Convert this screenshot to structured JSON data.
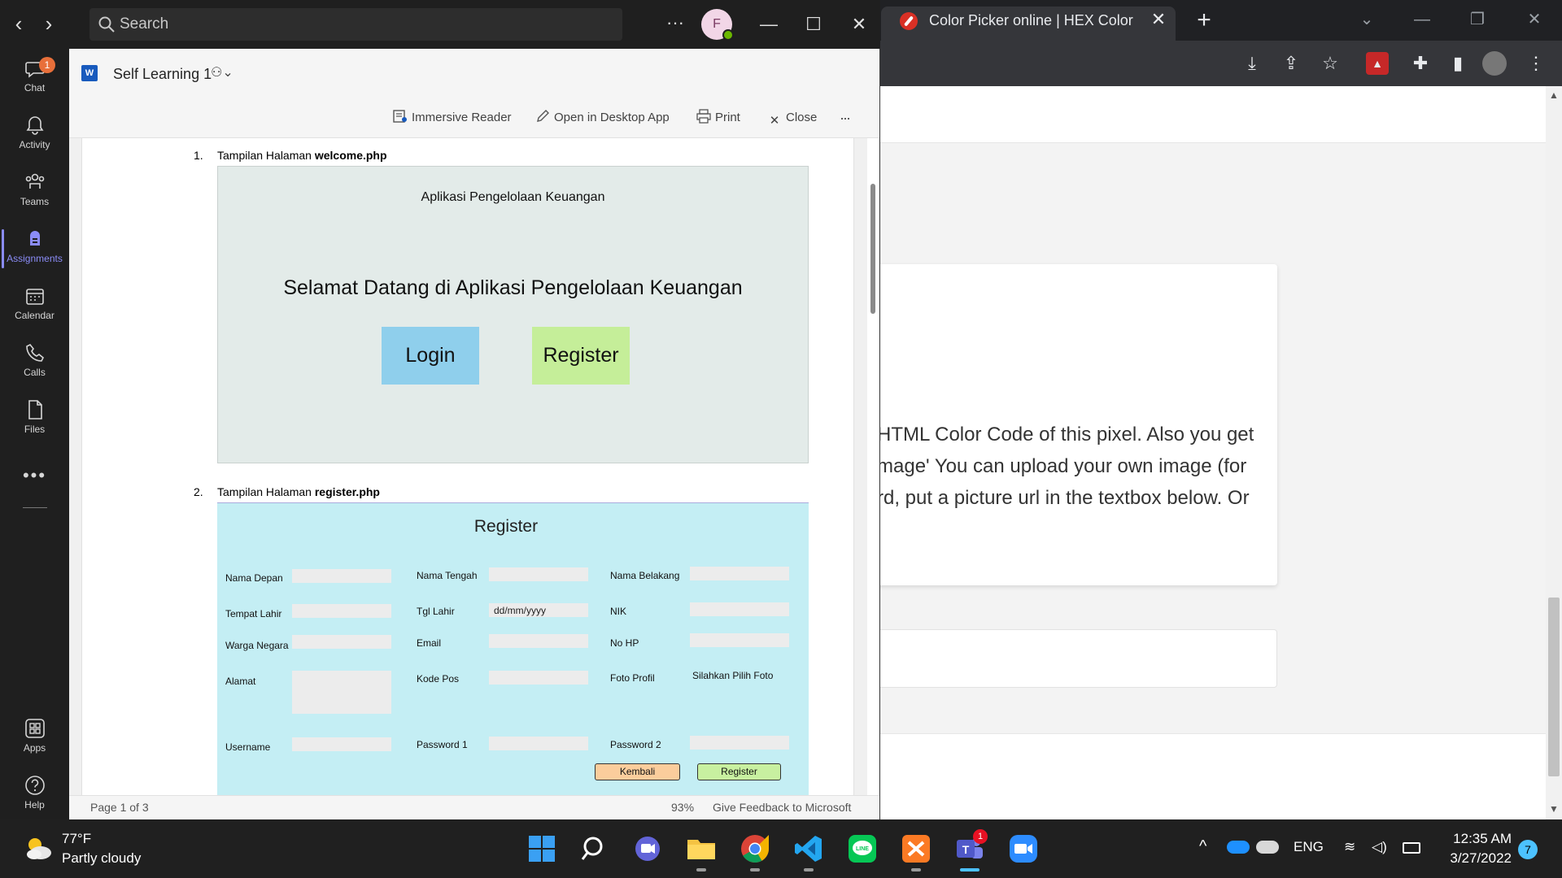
{
  "browser": {
    "tab_title": "Color Picker online | HEX Color",
    "page_text": "HTML Color Code of this pixel. Also you get 'mage' You can upload your own image (for rd, put a picture url in the textbox below. Or",
    "page_lines": [
      "HTML Color Code of this pixel. Also you get",
      "mage' You can upload your own image (for",
      "rd, put a picture url in the textbox below. Or"
    ]
  },
  "teams": {
    "search_placeholder": "Search",
    "avatar_initial": "F",
    "rail": [
      {
        "label": "Chat",
        "icon": "chat-icon",
        "badge": "1"
      },
      {
        "label": "Activity",
        "icon": "bell-icon"
      },
      {
        "label": "Teams",
        "icon": "teams-icon"
      },
      {
        "label": "Assignments",
        "icon": "assignments-icon",
        "active": true
      },
      {
        "label": "Calendar",
        "icon": "calendar-icon"
      },
      {
        "label": "Calls",
        "icon": "phone-icon"
      },
      {
        "label": "Files",
        "icon": "file-icon"
      },
      {
        "label": "Apps",
        "icon": "apps-icon"
      },
      {
        "label": "Help",
        "icon": "help-icon"
      }
    ],
    "rail_more": "•••"
  },
  "word": {
    "app_badge": "W",
    "doc_name": "Self Learning 1",
    "commands": {
      "immersive_reader": "Immersive Reader",
      "open_desktop": "Open in Desktop App",
      "print": "Print",
      "close": "Close",
      "more": "···"
    },
    "status": {
      "page": "Page 1 of 3",
      "zoom": "93%",
      "feedback": "Give Feedback to Microsoft"
    },
    "items": [
      {
        "num": "1.",
        "prefix": "Tampilan Halaman ",
        "file": "welcome.php"
      },
      {
        "num": "2.",
        "prefix": "Tampilan Halaman ",
        "file": "register.php"
      }
    ],
    "welcome_mock": {
      "app_title": "Aplikasi Pengelolaan Keuangan",
      "heading": "Selamat Datang di Aplikasi Pengelolaan Keuangan",
      "login": "Login",
      "register": "Register",
      "colors": {
        "login": "#8fcfec",
        "register": "#c5ee99",
        "background": "#e3ebe9"
      }
    },
    "register_mock": {
      "title": "Register",
      "labels": {
        "nama_depan": "Nama Depan",
        "nama_tengah": "Nama Tengah",
        "nama_belakang": "Nama Belakang",
        "tempat_lahir": "Tempat Lahir",
        "tgl_lahir": "Tgl Lahir",
        "nik": "NIK",
        "warga_negara": "Warga Negara",
        "email": "Email",
        "no_hp": "No HP",
        "alamat": "Alamat",
        "kode_pos": "Kode Pos",
        "foto_profil": "Foto Profil",
        "username": "Username",
        "password1": "Password 1",
        "password2": "Password 2"
      },
      "date_placeholder": "dd/mm/yyyy",
      "photo_hint": "Silahkan Pilih Foto",
      "kembali": "Kembali",
      "register_btn": "Register",
      "colors": {
        "background": "#c4eef4",
        "kembali": "#fbcd9c",
        "register": "#c8f0a0"
      }
    }
  },
  "taskbar": {
    "temperature": "77°F",
    "condition": "Partly cloudy",
    "language": "ENG",
    "time": "12:35 AM",
    "date": "3/27/2022",
    "notifications": "7",
    "teams_badge": "1"
  }
}
